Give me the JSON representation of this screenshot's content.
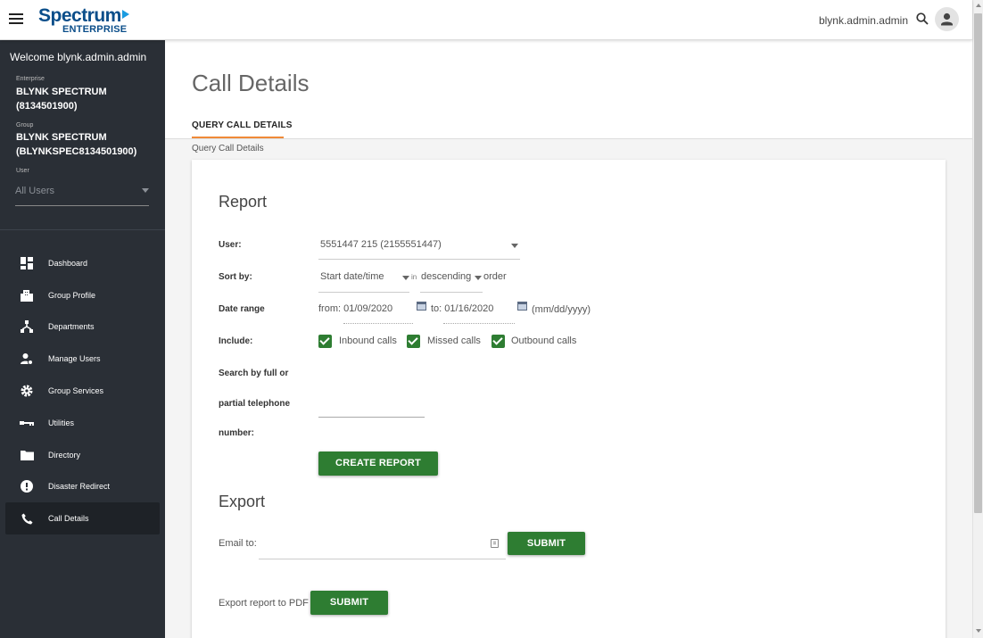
{
  "header": {
    "logo_main": "Spectrum",
    "logo_sub": "ENTERPRISE",
    "username": "blynk.admin.admin",
    "icons": [
      "menu-icon",
      "search-icon",
      "account-icon"
    ]
  },
  "sidebar": {
    "welcome": "Welcome blynk.admin.admin",
    "enterprise_label": "Enterprise",
    "enterprise_name": "BLYNK SPECTRUM",
    "enterprise_id": "(8134501900)",
    "group_label": "Group",
    "group_name": "BLYNK SPECTRUM",
    "group_id": "(BLYNKSPEC8134501900)",
    "user_label": "User",
    "user_value": "All Users",
    "items": [
      {
        "label": "Dashboard",
        "icon": "dashboard-icon"
      },
      {
        "label": "Group Profile",
        "icon": "building-icon"
      },
      {
        "label": "Departments",
        "icon": "hierarchy-icon"
      },
      {
        "label": "Manage Users",
        "icon": "user-settings-icon"
      },
      {
        "label": "Group Services",
        "icon": "gear-icon"
      },
      {
        "label": "Utilities",
        "icon": "key-icon"
      },
      {
        "label": "Directory",
        "icon": "folder-icon"
      },
      {
        "label": "Disaster Redirect",
        "icon": "alert-icon"
      },
      {
        "label": "Call Details",
        "icon": "phone-icon",
        "active": true
      }
    ]
  },
  "main": {
    "title": "Call Details",
    "tab": "QUERY CALL DETAILS",
    "breadcrumb": "Query Call Details",
    "report": {
      "title": "Report",
      "user_label": "User:",
      "user_value": "5551447 215 (2155551447)",
      "sort_label": "Sort by:",
      "sort_field": "Start date/time",
      "sort_in": "in",
      "sort_order": "descending",
      "sort_suffix": "order",
      "date_label": "Date range",
      "from_value": "from: 01/09/2020",
      "to_value": "to: 01/16/2020",
      "date_format": "(mm/dd/yyyy)",
      "include_label": "Include:",
      "include_options": [
        {
          "label": "Inbound calls",
          "checked": true
        },
        {
          "label": "Missed calls",
          "checked": true
        },
        {
          "label": "Outbound calls",
          "checked": true
        }
      ],
      "search_label_1": "Search by full or",
      "search_label_2": "partial telephone",
      "search_label_3": "number:",
      "search_value": "",
      "create_button": "CREATE REPORT"
    },
    "export": {
      "title": "Export",
      "email_label": "Email to:",
      "email_value": "",
      "submit_button": "SUBMIT",
      "pdf_label": "Export report to PDF",
      "pdf_button": "SUBMIT"
    }
  },
  "colors": {
    "brand_blue": "#0b4e8a",
    "sidebar_bg": "#2a2f36",
    "accent_orange": "#f08a38",
    "button_green": "#2e7d32"
  }
}
